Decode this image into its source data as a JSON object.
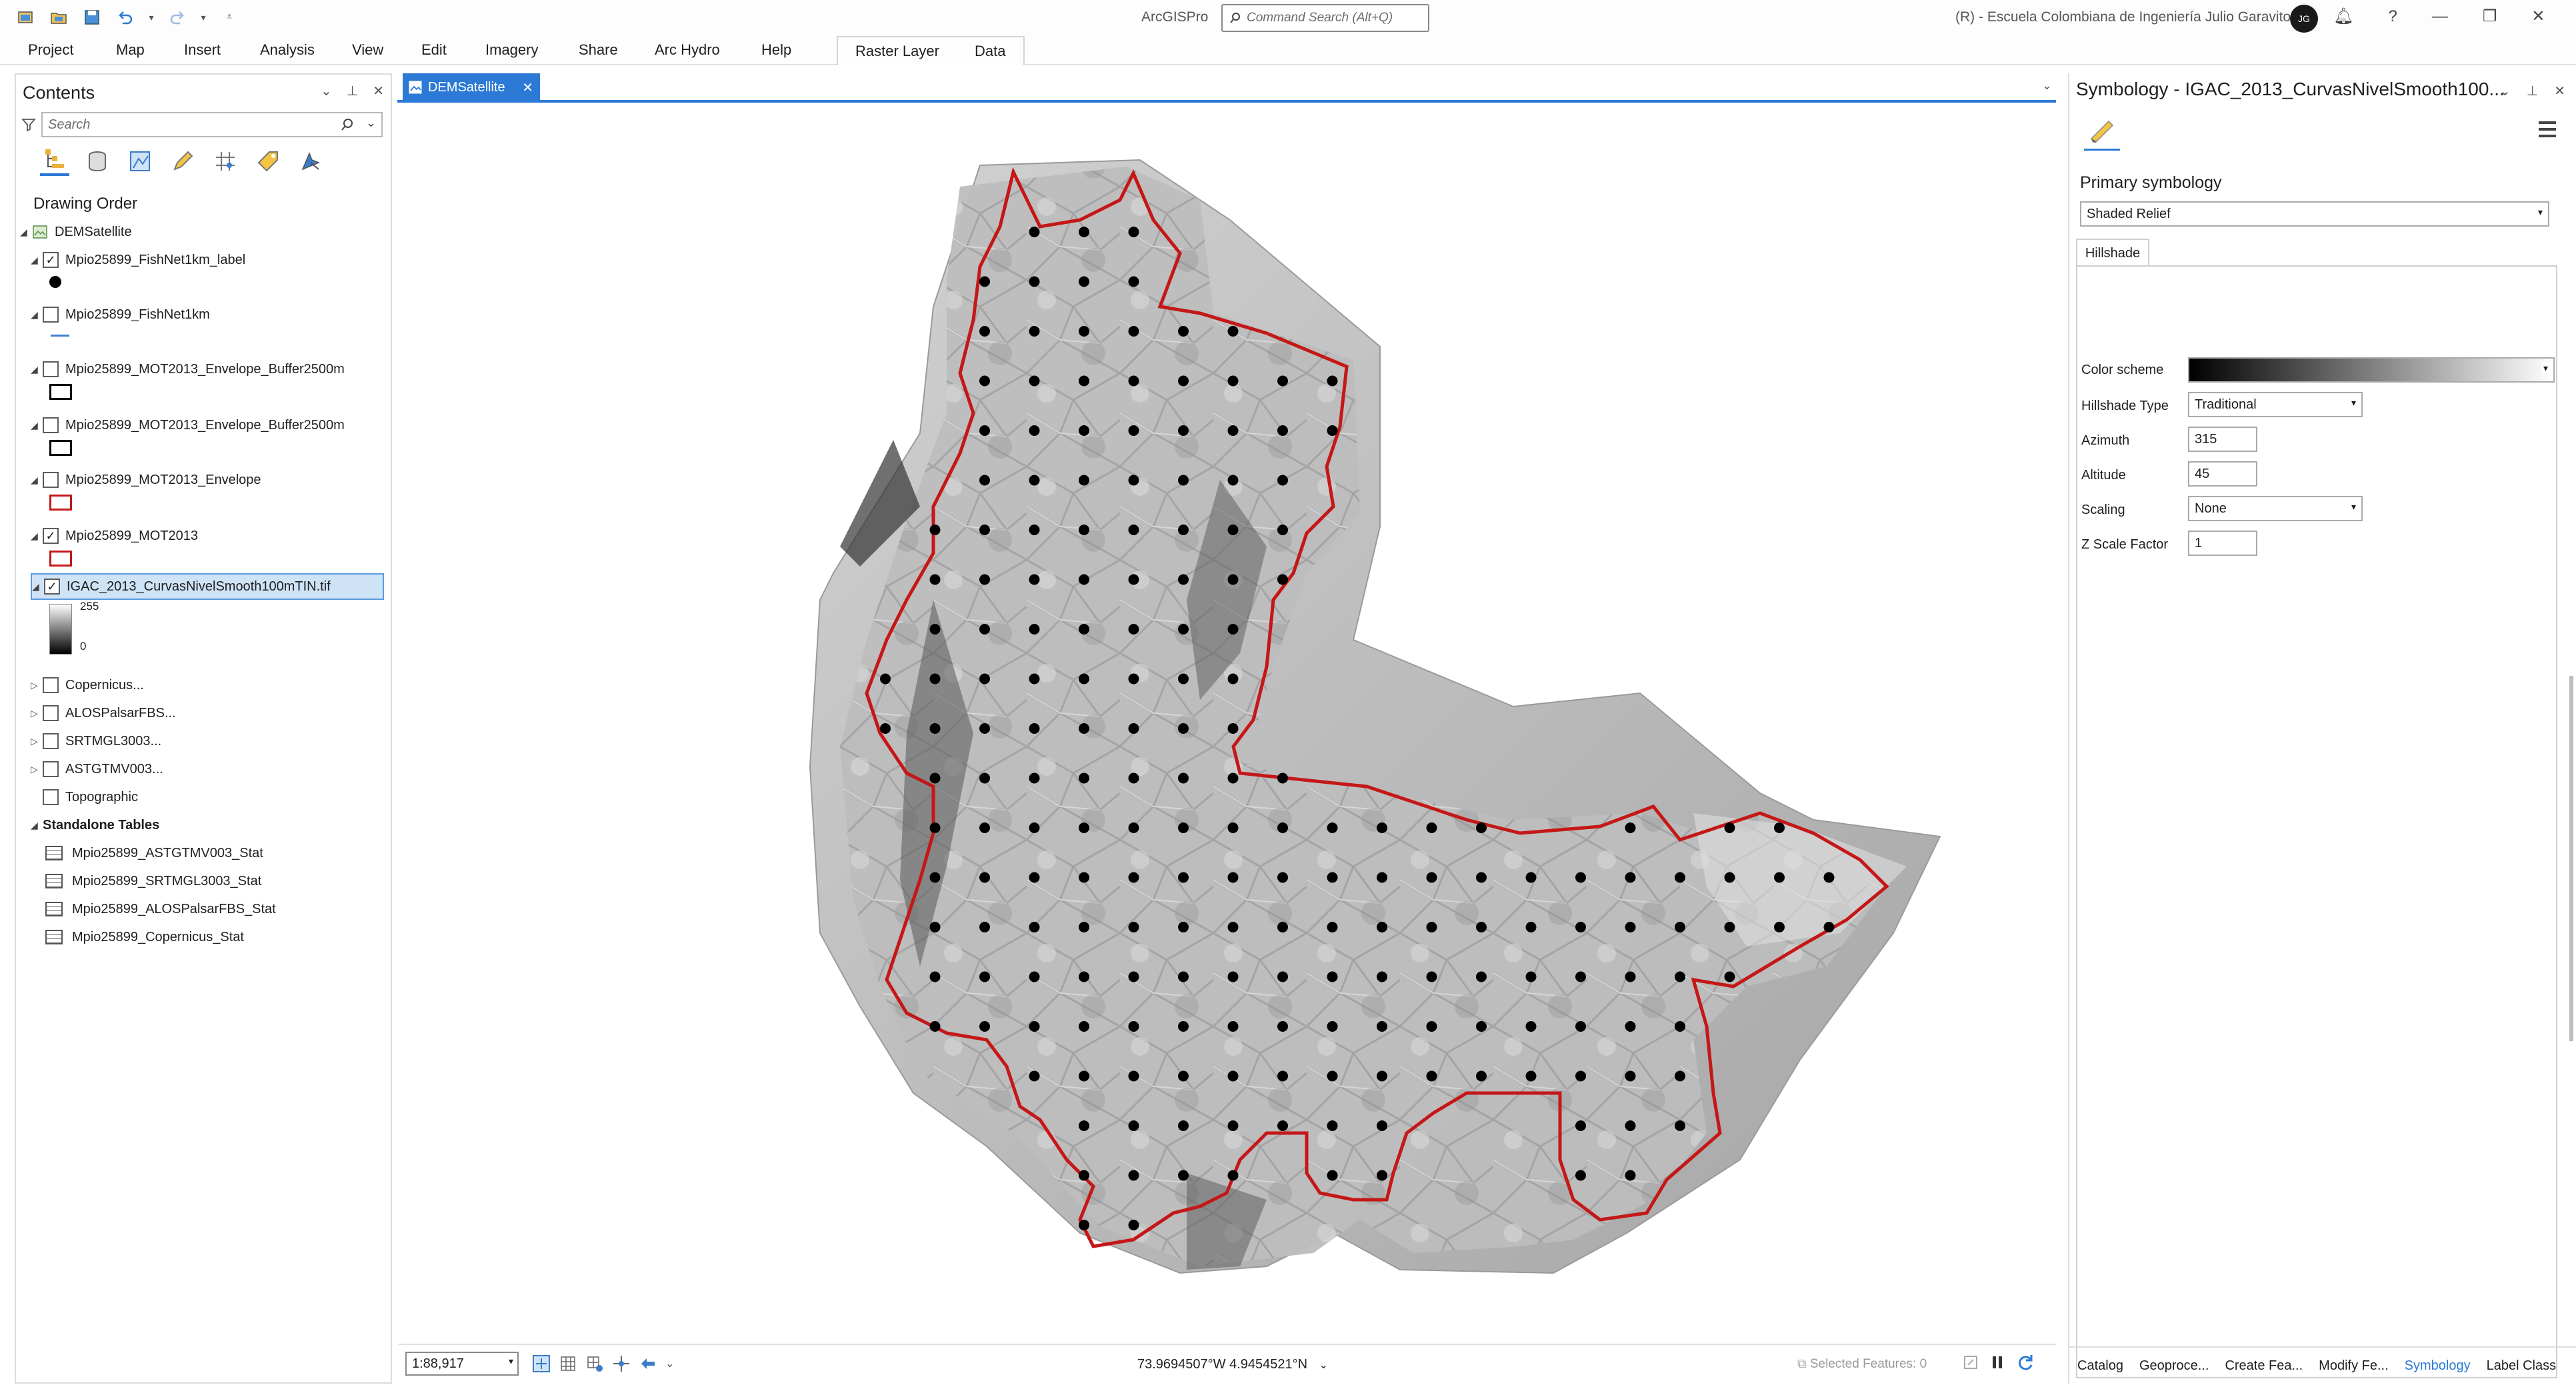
{
  "title_bar": {
    "app_title": "ArcGISPro",
    "command_search_placeholder": "Command Search (Alt+Q)",
    "license": "(R) - Escuela Colombiana de Ingeniería Julio Garavito",
    "avatar_initials": "JG"
  },
  "ribbon": {
    "tabs": [
      "Project",
      "Map",
      "Insert",
      "Analysis",
      "View",
      "Edit",
      "Imagery",
      "Share",
      "Arc Hydro",
      "Help"
    ],
    "context_tabs": [
      "Raster Layer",
      "Data"
    ]
  },
  "contents": {
    "title": "Contents",
    "search_placeholder": "Search",
    "drawing_order_label": "Drawing Order",
    "map_name": "DEMSatellite",
    "layers": [
      {
        "name": "Mpio25899_FishNet1km_label",
        "checked": true
      },
      {
        "name": "Mpio25899_FishNet1km",
        "checked": false
      },
      {
        "name": "Mpio25899_MOT2013_Envelope_Buffer2500m",
        "checked": false
      },
      {
        "name": "Mpio25899_MOT2013_Envelope_Buffer2500m",
        "checked": false
      },
      {
        "name": "Mpio25899_MOT2013_Envelope",
        "checked": false
      },
      {
        "name": "Mpio25899_MOT2013",
        "checked": true
      },
      {
        "name": "IGAC_2013_CurvasNivelSmooth100mTIN.tif",
        "checked": true
      },
      {
        "name": "Copernicus...",
        "checked": false
      },
      {
        "name": "ALOSPalsarFBS...",
        "checked": false
      },
      {
        "name": "SRTMGL3003...",
        "checked": false
      },
      {
        "name": "ASTGTMV003...",
        "checked": false
      },
      {
        "name": "Topographic",
        "checked": false
      }
    ],
    "raster_legend": {
      "high": "255",
      "low": "0"
    },
    "standalone_tables_label": "Standalone Tables",
    "tables": [
      "Mpio25899_ASTGTMV003_Stat",
      "Mpio25899_SRTMGL3003_Stat",
      "Mpio25899_ALOSPalsarFBS_Stat",
      "Mpio25899_Copernicus_Stat"
    ]
  },
  "map_view": {
    "tab_label": "DEMSatellite",
    "scale": "1:88,917",
    "coordinates": "73.9694507°W 4.9454521°N",
    "selected_features": "Selected Features: 0"
  },
  "symbology": {
    "title": "Symbology - IGAC_2013_CurvasNivelSmooth100...",
    "primary_label": "Primary symbology",
    "primary_value": "Shaded Relief",
    "tab": "Hillshade",
    "color_scheme_label": "Color scheme",
    "hillshade_type_label": "Hillshade Type",
    "hillshade_type": "Traditional",
    "azimuth_label": "Azimuth",
    "azimuth": "315",
    "altitude_label": "Altitude",
    "altitude": "45",
    "scaling_label": "Scaling",
    "scaling": "None",
    "zscale_label": "Z Scale Factor",
    "zscale": "1"
  },
  "bottom_tabs": [
    "Catalog",
    "Geoproce...",
    "Create Fea...",
    "Modify Fe...",
    "Symbology",
    "Label Class"
  ],
  "colors": {
    "accent": "#2c7ad6",
    "boundary": "#c51717",
    "relief_base": "#b9b9b9"
  }
}
